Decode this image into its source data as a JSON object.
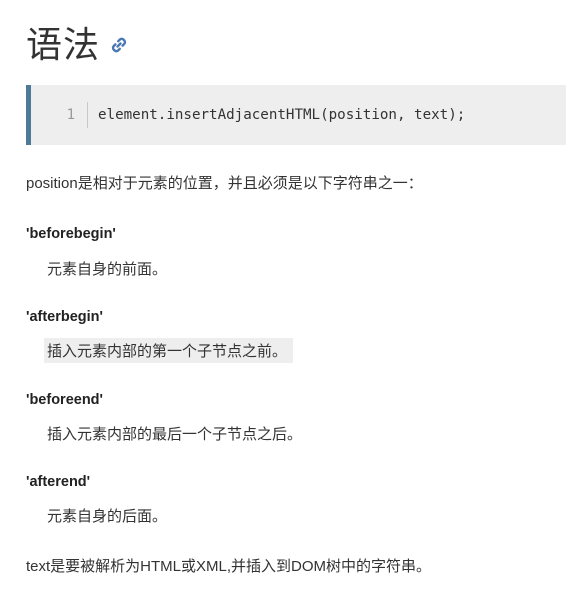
{
  "title": "语法",
  "code": {
    "line_number": "1",
    "text": "element.insertAdjacentHTML(position, text);"
  },
  "intro": "position是相对于元素的位置，并且必须是以下字符串之一：",
  "positions": [
    {
      "term": "'beforebegin'",
      "description": "元素自身的前面。"
    },
    {
      "term": "'afterbegin'",
      "description": "插入元素内部的第一个子节点之前。"
    },
    {
      "term": "'beforeend'",
      "description": "插入元素内部的最后一个子节点之后。"
    },
    {
      "term": "'afterend'",
      "description": "元素自身的后面。"
    }
  ],
  "text_description": "text是要被解析为HTML或XML,并插入到DOM树中的字符串。",
  "colors": {
    "code_border": "#4d7a97",
    "code_background": "#eeeeee",
    "link_icon": "#4a78b5"
  },
  "icons": {
    "permalink": "link-icon"
  }
}
